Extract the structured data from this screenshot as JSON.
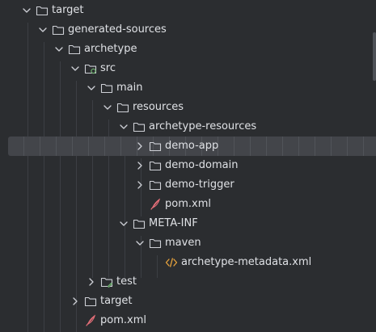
{
  "tree": {
    "rows": [
      {
        "label": "target",
        "icon": "folder-icon",
        "expanded": true
      },
      {
        "label": "generated-sources",
        "icon": "folder-icon",
        "expanded": true
      },
      {
        "label": "archetype",
        "icon": "folder-icon",
        "expanded": true
      },
      {
        "label": "src",
        "icon": "source-folder-icon",
        "expanded": true
      },
      {
        "label": "main",
        "icon": "folder-icon",
        "expanded": true
      },
      {
        "label": "resources",
        "icon": "folder-icon",
        "expanded": true
      },
      {
        "label": "archetype-resources",
        "icon": "folder-icon",
        "expanded": true
      },
      {
        "label": "demo-app",
        "icon": "folder-icon",
        "expanded": false,
        "selected": true
      },
      {
        "label": "demo-domain",
        "icon": "folder-icon",
        "expanded": false
      },
      {
        "label": "demo-trigger",
        "icon": "folder-icon",
        "expanded": false
      },
      {
        "label": "pom.xml",
        "icon": "maven-file-icon"
      },
      {
        "label": "META-INF",
        "icon": "folder-icon",
        "expanded": true
      },
      {
        "label": "maven",
        "icon": "folder-icon",
        "expanded": true
      },
      {
        "label": "archetype-metadata.xml",
        "icon": "xml-file-icon"
      },
      {
        "label": "test",
        "icon": "test-folder-icon",
        "expanded": false
      },
      {
        "label": "target",
        "icon": "folder-icon",
        "expanded": false
      },
      {
        "label": "pom.xml",
        "icon": "maven-file-icon"
      }
    ]
  },
  "colors": {
    "background": "#2b2d30",
    "selection": "#43454a",
    "text": "#dfe1e5",
    "icon_stroke": "#ced0d6",
    "maven_icon": "#e8707a",
    "xml_icon": "#e8a33c",
    "source_marker": "#6fb16f",
    "test_marker": "#6fb16f"
  }
}
